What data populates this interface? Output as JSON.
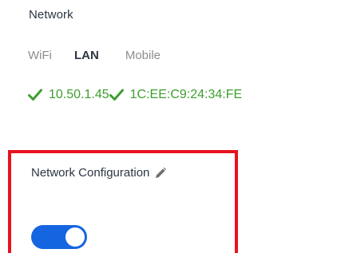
{
  "network": {
    "title": "Network",
    "tabs": [
      {
        "label": "WiFi",
        "active": false
      },
      {
        "label": "LAN",
        "active": true
      },
      {
        "label": "Mobile",
        "active": false
      }
    ],
    "status": {
      "ip_address": "10.50.1.45",
      "mac_address": "1C:EE:C9:24:34:FE",
      "status_color": "#3d9f2e"
    }
  },
  "configuration": {
    "title": "Network Configuration",
    "edit_icon": "pencil-icon",
    "toggle_enabled": true,
    "toggle_color": "#1565e0",
    "highlight_color": "#e8121e"
  }
}
